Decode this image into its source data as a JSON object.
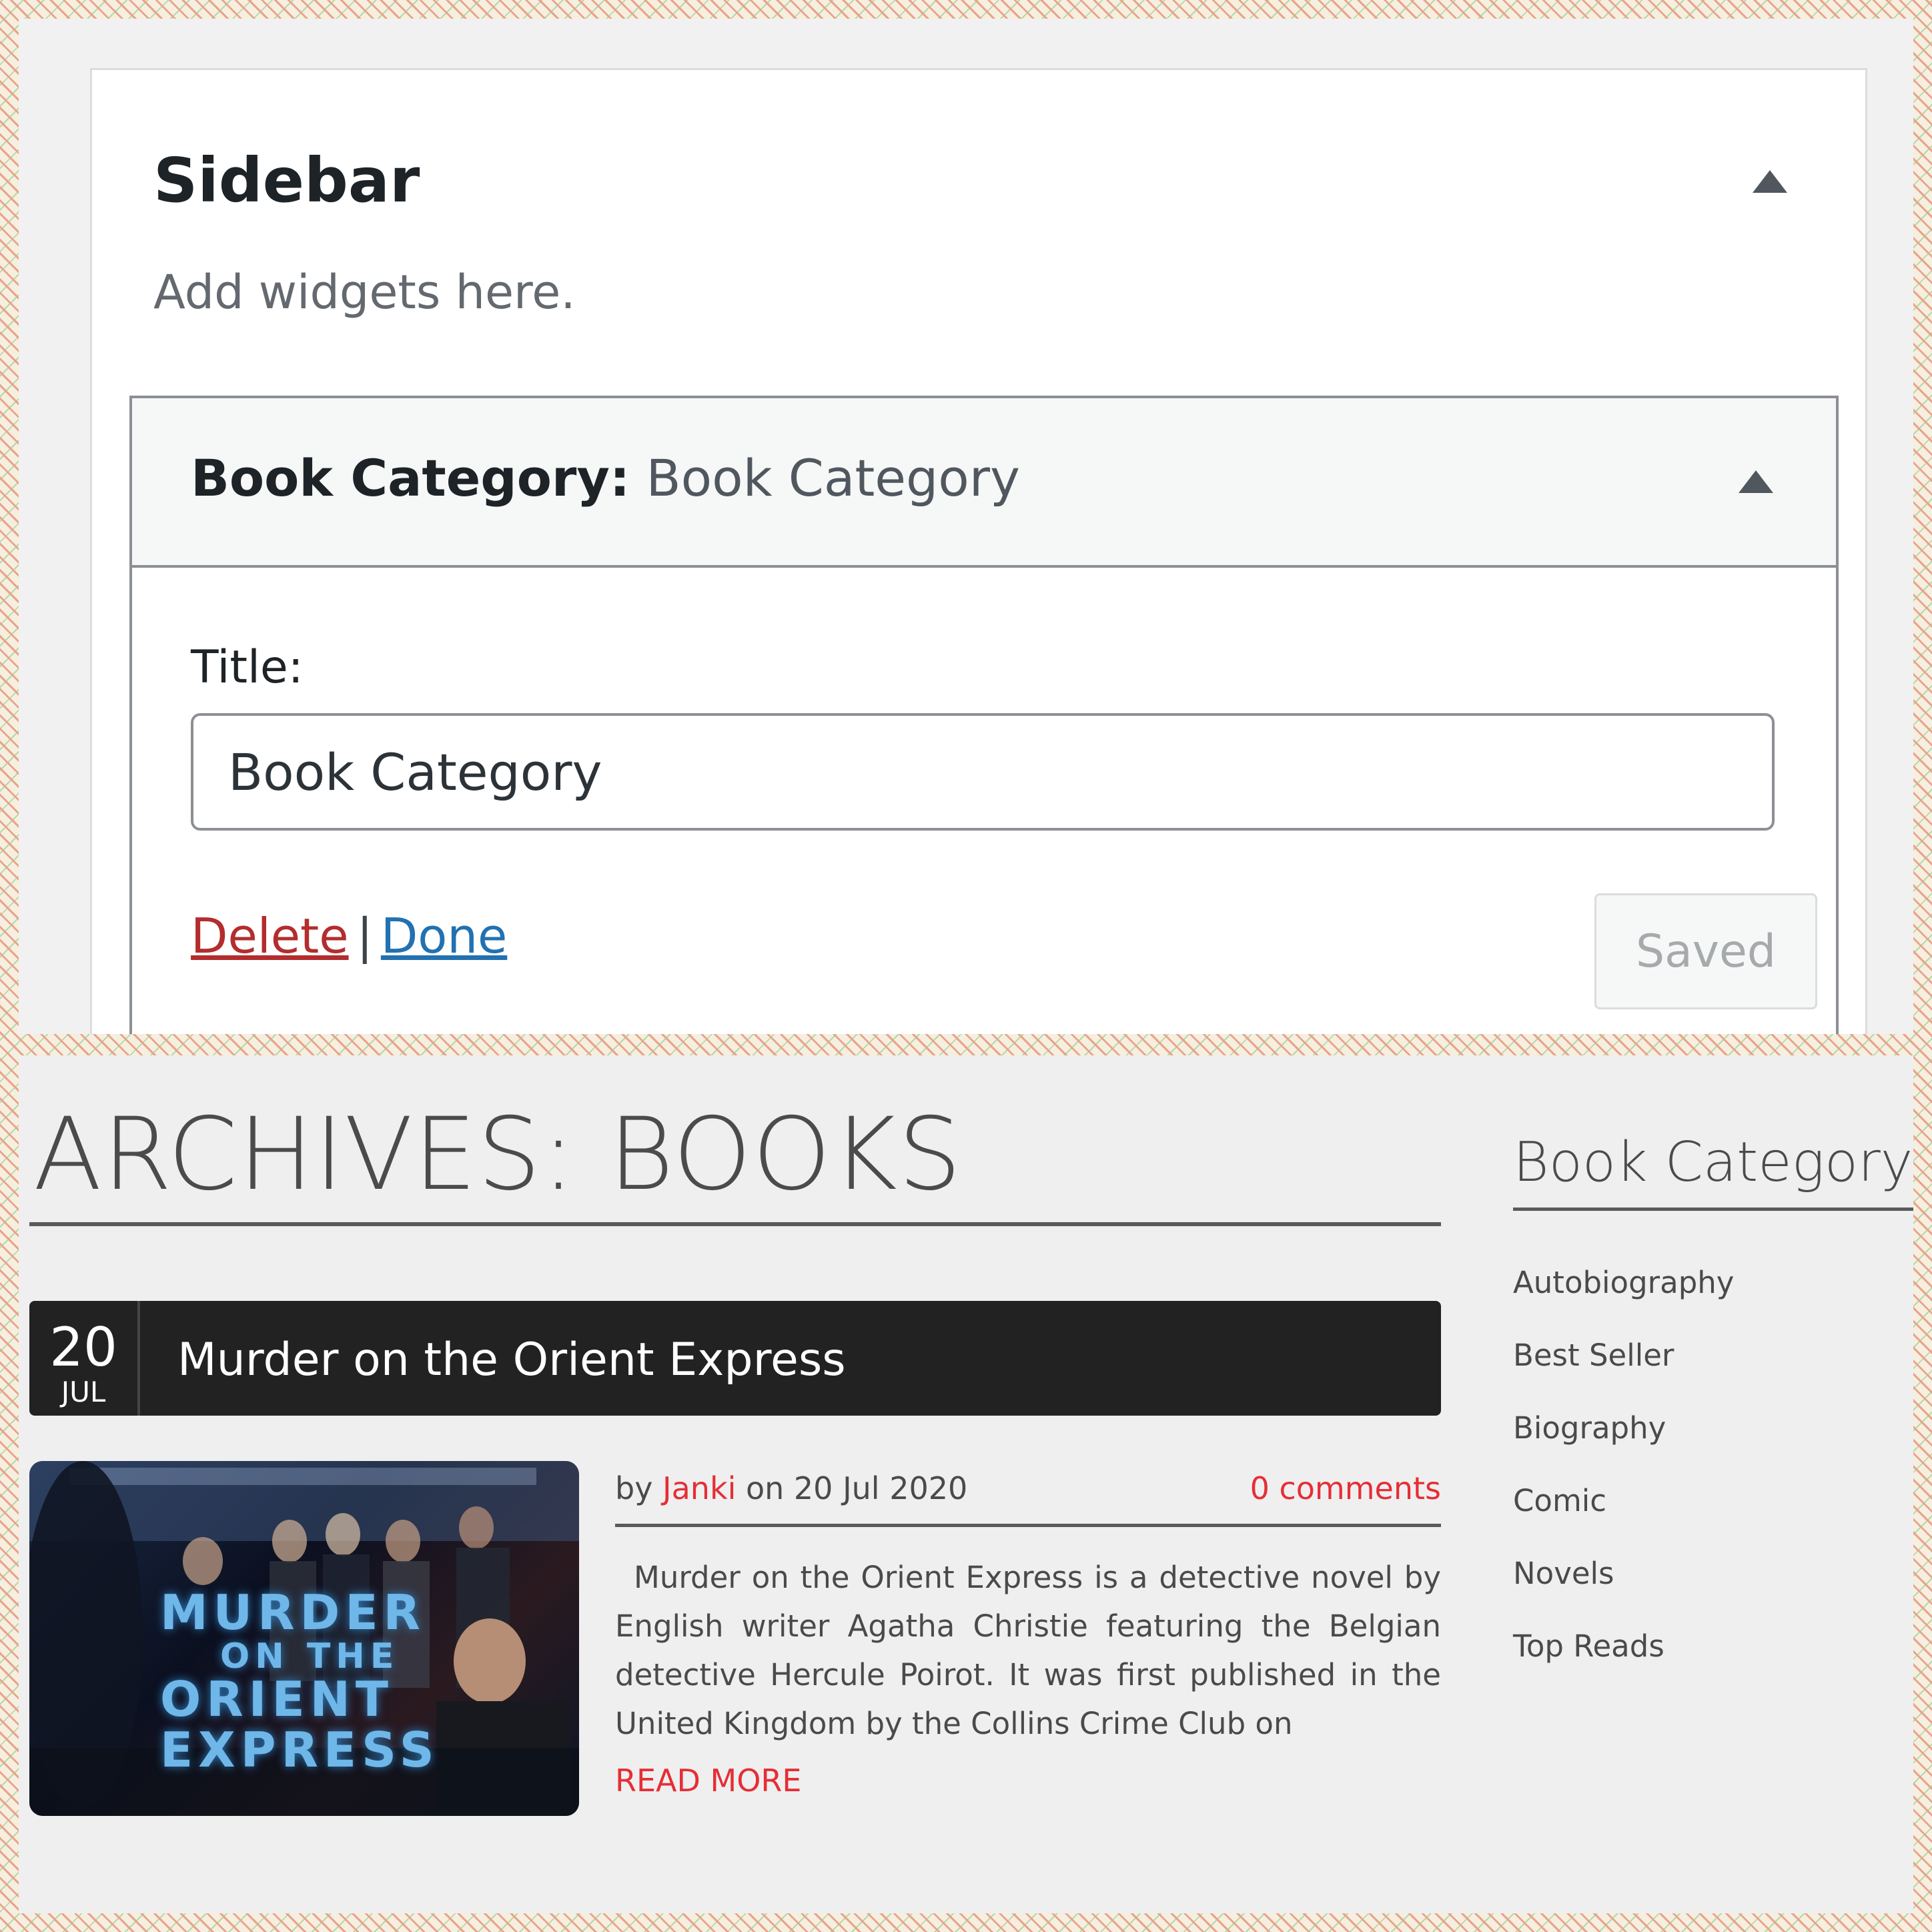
{
  "editor": {
    "sidebar_title": "Sidebar",
    "sidebar_description": "Add widgets here.",
    "widget": {
      "header_label": "Book Category:",
      "header_subtitle": "Book Category",
      "title_label": "Title:",
      "title_value": "Book Category",
      "delete_label": "Delete",
      "separator": "|",
      "done_label": "Done",
      "saved_label": "Saved"
    }
  },
  "archive": {
    "heading": "ARCHIVES: BOOKS",
    "post": {
      "day": "20",
      "month": "JUL",
      "title": "Murder on the Orient Express",
      "thumbnail_text": [
        "MURDER",
        "ON THE",
        "ORIENT",
        "EXPRESS"
      ],
      "meta_by": "by",
      "author": "Janki",
      "meta_on": "on 20 Jul 2020",
      "comments": "0 comments",
      "excerpt": "Murder on the Orient Express is a detective novel by English writer Agatha Christie featuring the Belgian detective Hercule Poirot. It was first published in the United Kingdom by the Collins Crime Club on",
      "read_more": "READ MORE"
    }
  },
  "category_widget": {
    "title": "Book Category",
    "items": [
      "Autobiography",
      "Best Seller",
      "Biography",
      "Comic",
      "Novels",
      "Top Reads"
    ]
  },
  "colors": {
    "accent_red": "#e52e36",
    "link_blue": "#2271b1",
    "delete_red": "#b32d2e",
    "post_header_bg": "#222222"
  },
  "icons": {
    "sidebar_toggle": "caret-up-icon",
    "widget_toggle": "caret-up-icon"
  }
}
